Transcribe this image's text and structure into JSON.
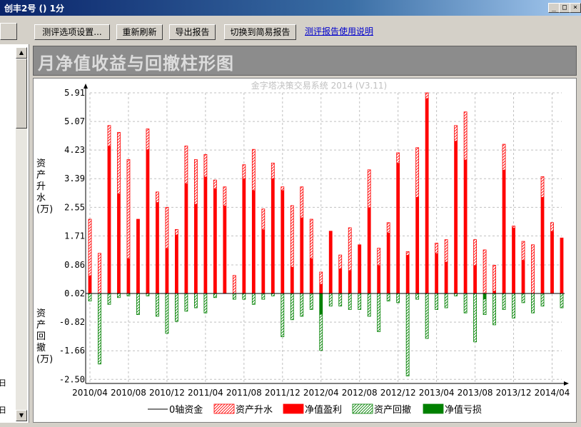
{
  "window": {
    "title": "创丰2号 () 1分",
    "min": "_",
    "max": "□",
    "close": "×"
  },
  "toolbar": {
    "options": "测评选项设置...",
    "refresh": "重新刷新",
    "export": "导出报告",
    "switch": "切换到简易报告",
    "help_link": "测评报告使用说明"
  },
  "left": {
    "items": [
      "日",
      "日"
    ]
  },
  "banner": {
    "title": "月净值收益与回撤柱形图"
  },
  "chart_data": {
    "type": "bar",
    "watermark": "金字塔决策交易系统 2014 (V3.11)",
    "ylabel_up": "资产升水(万)",
    "ylabel_down": "资产回撤(万)",
    "yticks": [
      5.91,
      5.07,
      4.23,
      3.39,
      2.55,
      1.71,
      0.86,
      0.02,
      -0.82,
      -1.66,
      -2.5
    ],
    "ylim": [
      -2.62,
      5.91
    ],
    "xticks": [
      "2010/04",
      "2010/08",
      "2010/12",
      "2011/04",
      "2011/08",
      "2011/12",
      "2012/04",
      "2012/08",
      "2012/12",
      "2013/04",
      "2013/08",
      "2013/12",
      "2014/04"
    ],
    "months": 49,
    "bars": [
      [
        2.2,
        0.55,
        -0.2,
        0.02
      ],
      [
        1.2,
        0.02,
        -2.05,
        0.02
      ],
      [
        4.95,
        4.35,
        -0.3,
        0.02
      ],
      [
        4.75,
        2.95,
        -0.1,
        0.02
      ],
      [
        3.95,
        1.05,
        -0.05,
        0.02
      ],
      [
        2.2,
        2.2,
        -0.6,
        0.02
      ],
      [
        4.85,
        4.25,
        -0.05,
        0.02
      ],
      [
        3.0,
        2.7,
        -0.65,
        0.02
      ],
      [
        2.55,
        1.35,
        -1.15,
        0.02
      ],
      [
        1.9,
        1.75,
        -0.8,
        0.02
      ],
      [
        4.35,
        3.25,
        -0.5,
        0.02
      ],
      [
        3.95,
        2.65,
        -0.4,
        0.02
      ],
      [
        4.1,
        3.45,
        -0.55,
        0.02
      ],
      [
        3.35,
        3.1,
        -0.1,
        0.02
      ],
      [
        3.15,
        2.6,
        0.02,
        0.02
      ],
      [
        0.55,
        0.02,
        -0.15,
        0.02
      ],
      [
        3.8,
        3.4,
        -0.15,
        0.02
      ],
      [
        4.25,
        3.05,
        -0.3,
        0.02
      ],
      [
        2.5,
        1.9,
        -0.15,
        0.02
      ],
      [
        3.85,
        3.4,
        -0.05,
        0.02
      ],
      [
        3.15,
        3.05,
        -1.25,
        0.02
      ],
      [
        2.6,
        0.8,
        -0.75,
        0.02
      ],
      [
        3.15,
        2.25,
        -0.65,
        0.02
      ],
      [
        2.2,
        1.05,
        -0.45,
        0.02
      ],
      [
        0.65,
        0.3,
        -1.65,
        -0.6
      ],
      [
        1.85,
        1.85,
        -0.35,
        0.02
      ],
      [
        1.15,
        0.75,
        -0.35,
        0.02
      ],
      [
        1.95,
        0.7,
        -0.45,
        0.02
      ],
      [
        1.45,
        1.45,
        -0.45,
        0.02
      ],
      [
        3.65,
        2.55,
        -0.65,
        0.02
      ],
      [
        1.35,
        0.85,
        -1.1,
        0.02
      ],
      [
        2.1,
        1.8,
        -0.2,
        0.02
      ],
      [
        4.15,
        3.85,
        -0.25,
        0.02
      ],
      [
        1.25,
        1.15,
        -2.4,
        0.02
      ],
      [
        4.3,
        2.85,
        -0.15,
        0.02
      ],
      [
        5.91,
        5.75,
        -1.3,
        0.02
      ],
      [
        1.5,
        1.2,
        -0.45,
        0.02
      ],
      [
        1.6,
        0.95,
        -0.4,
        0.02
      ],
      [
        4.95,
        4.5,
        -0.05,
        0.02
      ],
      [
        5.35,
        3.95,
        -0.55,
        0.02
      ],
      [
        1.6,
        0.85,
        -1.4,
        0.02
      ],
      [
        1.3,
        0.02,
        -0.6,
        -0.15
      ],
      [
        0.85,
        0.1,
        -0.9,
        0.02
      ],
      [
        4.4,
        3.65,
        -0.45,
        0.02
      ],
      [
        2.0,
        1.95,
        -0.7,
        0.02
      ],
      [
        1.55,
        1.0,
        -0.25,
        0.02
      ],
      [
        1.45,
        0.02,
        -0.55,
        0.02
      ],
      [
        3.45,
        2.85,
        -0.35,
        0.02
      ],
      [
        2.1,
        1.85,
        0.02,
        0.02
      ],
      [
        1.65,
        1.65,
        -0.4,
        0.02
      ]
    ],
    "legend": [
      "0轴资金",
      "资产升水",
      "净值盈利",
      "资产回撤",
      "净值亏损"
    ],
    "colors": {
      "profit": "#ff0000",
      "loss": "#008000",
      "up_hatch": "#ff0000",
      "down_hatch": "#008000",
      "grid": "#c0c0c0"
    }
  }
}
